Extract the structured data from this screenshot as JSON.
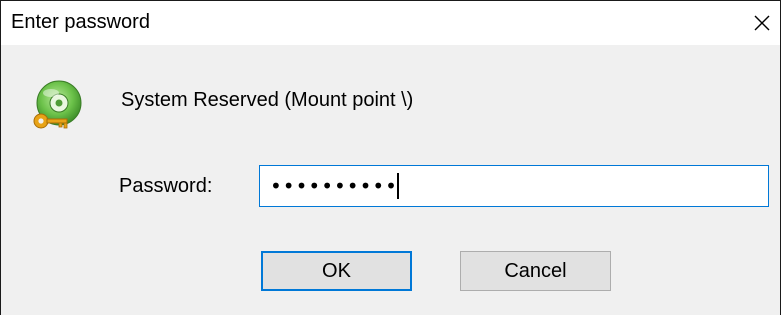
{
  "window": {
    "title": "Enter password",
    "close_icon": "close-icon"
  },
  "volume": {
    "icon": "drive-key-icon",
    "label": "System Reserved (Mount point \\)"
  },
  "password": {
    "label": "Password:",
    "value": "••••••••••"
  },
  "buttons": {
    "ok": "OK",
    "cancel": "Cancel"
  },
  "colors": {
    "focus_accent": "#0078d7",
    "icon_green": "#6cc24a",
    "key_gold": "#e8a317"
  }
}
